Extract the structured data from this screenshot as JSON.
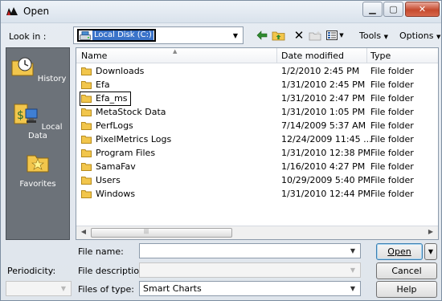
{
  "window": {
    "title": "Open"
  },
  "lookin": {
    "label": "Look in :",
    "value": "Local Disk (C:)"
  },
  "toolbar": {
    "tools_label": "Tools",
    "options_label": "Options"
  },
  "places": [
    {
      "label": "History"
    },
    {
      "label": "Local Data"
    },
    {
      "label": "Favorites"
    }
  ],
  "columns": {
    "name": "Name",
    "date": "Date modified",
    "type": "Type"
  },
  "files": [
    {
      "name": "Downloads",
      "date": "1/2/2010 2:45 PM",
      "type": "File folder"
    },
    {
      "name": "Efa",
      "date": "1/31/2010 2:45 PM",
      "type": "File folder"
    },
    {
      "name": "Efa_ms",
      "date": "1/31/2010 2:47 PM",
      "type": "File folder"
    },
    {
      "name": "MetaStock Data",
      "date": "1/31/2010 1:05 PM",
      "type": "File folder"
    },
    {
      "name": "PerfLogs",
      "date": "7/14/2009 5:37 AM",
      "type": "File folder"
    },
    {
      "name": "PixelMetrics Logs",
      "date": "12/24/2009 11:45 ...",
      "type": "File folder"
    },
    {
      "name": "Program Files",
      "date": "1/31/2010 12:38 PM",
      "type": "File folder"
    },
    {
      "name": "SamaFav",
      "date": "1/16/2010 4:27 PM",
      "type": "File folder"
    },
    {
      "name": "Users",
      "date": "10/29/2009 5:40 PM",
      "type": "File folder"
    },
    {
      "name": "Windows",
      "date": "1/31/2010 12:44 PM",
      "type": "File folder"
    }
  ],
  "form": {
    "filename_label": "File name:",
    "filename_value": "",
    "description_label": "File description:",
    "description_value": "",
    "filetype_label": "Files of type:",
    "filetype_value": "Smart Charts",
    "periodicity_label": "Periodicity:",
    "periodicity_value": ""
  },
  "buttons": {
    "open": "Open",
    "cancel": "Cancel",
    "help": "Help"
  },
  "colors": {
    "selection": "#3a73c9",
    "places_bg": "#6c7279",
    "close_button": "#c54a2e",
    "folder": "#f2c64c"
  }
}
